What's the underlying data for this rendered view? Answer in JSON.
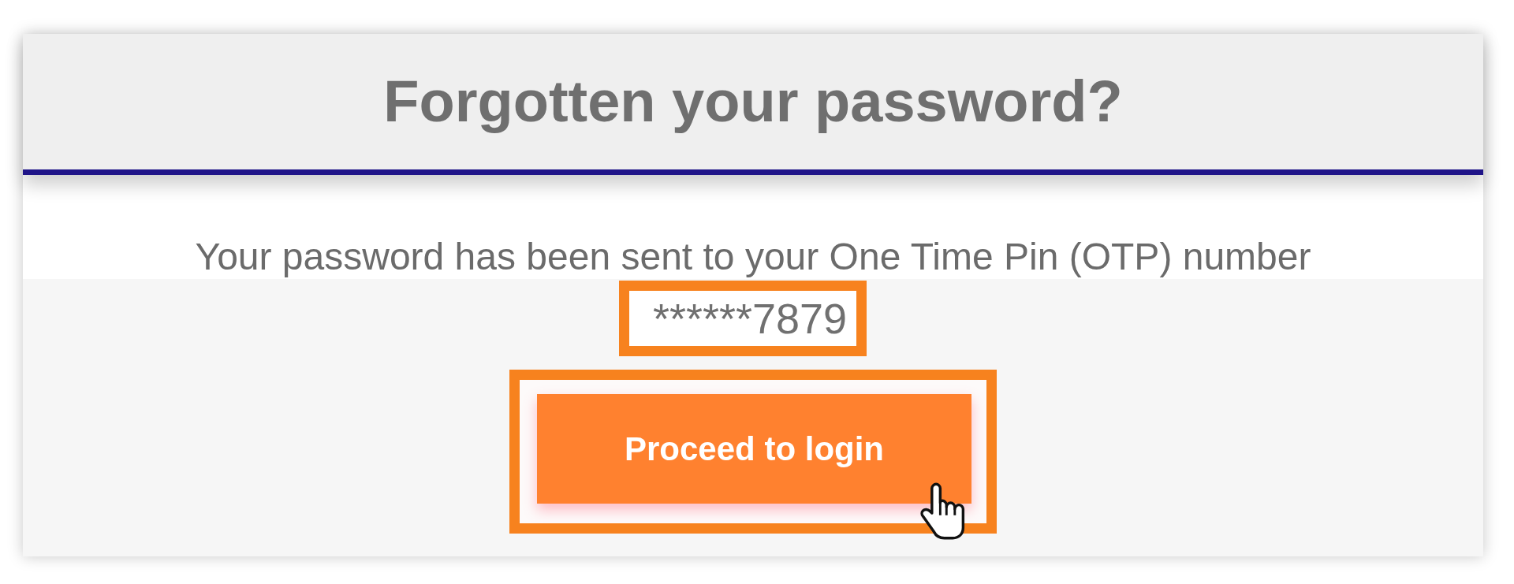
{
  "dialog": {
    "title": "Forgotten your password?"
  },
  "message": "Your password has been sent to your One Time Pin (OTP) number",
  "otp_number": {
    "value": "******7879",
    "highlighted": true
  },
  "button": {
    "label": "Proceed to login",
    "highlighted": true,
    "hovered": true
  }
}
